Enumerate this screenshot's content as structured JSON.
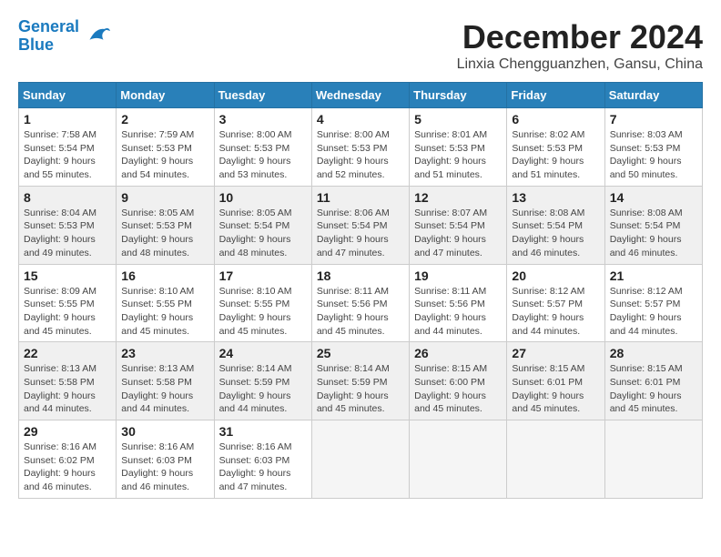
{
  "logo": {
    "line1": "General",
    "line2": "Blue"
  },
  "title": "December 2024",
  "location": "Linxia Chengguanzhen, Gansu, China",
  "weekdays": [
    "Sunday",
    "Monday",
    "Tuesday",
    "Wednesday",
    "Thursday",
    "Friday",
    "Saturday"
  ],
  "weeks": [
    [
      {
        "day": "1",
        "sunrise": "7:58 AM",
        "sunset": "5:54 PM",
        "daylight": "9 hours and 55 minutes."
      },
      {
        "day": "2",
        "sunrise": "7:59 AM",
        "sunset": "5:53 PM",
        "daylight": "9 hours and 54 minutes."
      },
      {
        "day": "3",
        "sunrise": "8:00 AM",
        "sunset": "5:53 PM",
        "daylight": "9 hours and 53 minutes."
      },
      {
        "day": "4",
        "sunrise": "8:00 AM",
        "sunset": "5:53 PM",
        "daylight": "9 hours and 52 minutes."
      },
      {
        "day": "5",
        "sunrise": "8:01 AM",
        "sunset": "5:53 PM",
        "daylight": "9 hours and 51 minutes."
      },
      {
        "day": "6",
        "sunrise": "8:02 AM",
        "sunset": "5:53 PM",
        "daylight": "9 hours and 51 minutes."
      },
      {
        "day": "7",
        "sunrise": "8:03 AM",
        "sunset": "5:53 PM",
        "daylight": "9 hours and 50 minutes."
      }
    ],
    [
      {
        "day": "8",
        "sunrise": "8:04 AM",
        "sunset": "5:53 PM",
        "daylight": "9 hours and 49 minutes."
      },
      {
        "day": "9",
        "sunrise": "8:05 AM",
        "sunset": "5:53 PM",
        "daylight": "9 hours and 48 minutes."
      },
      {
        "day": "10",
        "sunrise": "8:05 AM",
        "sunset": "5:54 PM",
        "daylight": "9 hours and 48 minutes."
      },
      {
        "day": "11",
        "sunrise": "8:06 AM",
        "sunset": "5:54 PM",
        "daylight": "9 hours and 47 minutes."
      },
      {
        "day": "12",
        "sunrise": "8:07 AM",
        "sunset": "5:54 PM",
        "daylight": "9 hours and 47 minutes."
      },
      {
        "day": "13",
        "sunrise": "8:08 AM",
        "sunset": "5:54 PM",
        "daylight": "9 hours and 46 minutes."
      },
      {
        "day": "14",
        "sunrise": "8:08 AM",
        "sunset": "5:54 PM",
        "daylight": "9 hours and 46 minutes."
      }
    ],
    [
      {
        "day": "15",
        "sunrise": "8:09 AM",
        "sunset": "5:55 PM",
        "daylight": "9 hours and 45 minutes."
      },
      {
        "day": "16",
        "sunrise": "8:10 AM",
        "sunset": "5:55 PM",
        "daylight": "9 hours and 45 minutes."
      },
      {
        "day": "17",
        "sunrise": "8:10 AM",
        "sunset": "5:55 PM",
        "daylight": "9 hours and 45 minutes."
      },
      {
        "day": "18",
        "sunrise": "8:11 AM",
        "sunset": "5:56 PM",
        "daylight": "9 hours and 45 minutes."
      },
      {
        "day": "19",
        "sunrise": "8:11 AM",
        "sunset": "5:56 PM",
        "daylight": "9 hours and 44 minutes."
      },
      {
        "day": "20",
        "sunrise": "8:12 AM",
        "sunset": "5:57 PM",
        "daylight": "9 hours and 44 minutes."
      },
      {
        "day": "21",
        "sunrise": "8:12 AM",
        "sunset": "5:57 PM",
        "daylight": "9 hours and 44 minutes."
      }
    ],
    [
      {
        "day": "22",
        "sunrise": "8:13 AM",
        "sunset": "5:58 PM",
        "daylight": "9 hours and 44 minutes."
      },
      {
        "day": "23",
        "sunrise": "8:13 AM",
        "sunset": "5:58 PM",
        "daylight": "9 hours and 44 minutes."
      },
      {
        "day": "24",
        "sunrise": "8:14 AM",
        "sunset": "5:59 PM",
        "daylight": "9 hours and 44 minutes."
      },
      {
        "day": "25",
        "sunrise": "8:14 AM",
        "sunset": "5:59 PM",
        "daylight": "9 hours and 45 minutes."
      },
      {
        "day": "26",
        "sunrise": "8:15 AM",
        "sunset": "6:00 PM",
        "daylight": "9 hours and 45 minutes."
      },
      {
        "day": "27",
        "sunrise": "8:15 AM",
        "sunset": "6:01 PM",
        "daylight": "9 hours and 45 minutes."
      },
      {
        "day": "28",
        "sunrise": "8:15 AM",
        "sunset": "6:01 PM",
        "daylight": "9 hours and 45 minutes."
      }
    ],
    [
      {
        "day": "29",
        "sunrise": "8:16 AM",
        "sunset": "6:02 PM",
        "daylight": "9 hours and 46 minutes."
      },
      {
        "day": "30",
        "sunrise": "8:16 AM",
        "sunset": "6:03 PM",
        "daylight": "9 hours and 46 minutes."
      },
      {
        "day": "31",
        "sunrise": "8:16 AM",
        "sunset": "6:03 PM",
        "daylight": "9 hours and 47 minutes."
      },
      null,
      null,
      null,
      null
    ]
  ]
}
